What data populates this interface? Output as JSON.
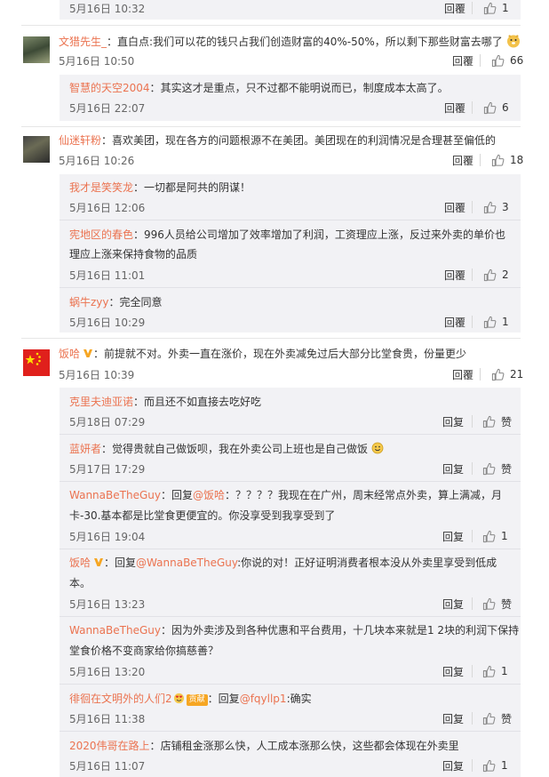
{
  "labels": {
    "reply": "回覆",
    "reply2": "回复",
    "like": "赞",
    "reply_prefix": "回复"
  },
  "top_item": {
    "time": "5月16日 10:32",
    "likes": "1"
  },
  "comments": [
    {
      "name": "文猎先生_",
      "text": "直白点:我们可以花的钱只占我们创造财富的40%-50%，所以剩下那些财富去哪了",
      "time": "5月16日 10:50",
      "likes": "66",
      "replies": [
        {
          "name": "智慧的天空2004",
          "text": "其实这才是重点，只不过都不能明说而已，制度成本太高了。",
          "time": "5月16日 22:07",
          "likes": "6"
        }
      ]
    },
    {
      "name": "仙迷轩粉",
      "text": "喜欢美团，现在各方的问题根源不在美团。美团现在的利润情况是合理甚至偏低的",
      "time": "5月16日 10:26",
      "likes": "18",
      "replies": [
        {
          "name": "我才是笑笑龙",
          "text": "一切都是阿共的阴谋！",
          "time": "5月16日 12:06",
          "likes": "3"
        },
        {
          "name": "宪地区的春色",
          "text": "996人员给公司增加了效率增加了利润，工资理应上涨，反过来外卖的单价也",
          "text2": "理应上涨来保持食物的品质",
          "time": "5月16日 11:01",
          "likes": "2"
        },
        {
          "name": "蜗牛zyy",
          "text": "完全同意",
          "time": "5月16日 10:29",
          "likes": "1"
        }
      ]
    },
    {
      "name": "饭哈",
      "text": "前提就不对。外卖一直在涨价，现在外卖减免过后大部分比堂食贵，份量更少",
      "time": "5月16日 10:39",
      "likes": "21",
      "replies": [
        {
          "name": "克里夫迪亚诺",
          "text": "而且还不如直接去吃好吃",
          "time": "5月18日 07:29",
          "likes": "赞"
        },
        {
          "name": "蓝妍者",
          "text": "觉得贵就自己做饭呗，我在外卖公司上班也是自己做饭",
          "time": "5月17日 17:29",
          "likes": "赞"
        },
        {
          "name": "WannaBeTheGuy",
          "at": "@饭哈",
          "text": "：？？？？我现在在广州，周末经常点外卖，算上满减，月",
          "text2": "卡-30.基本都是比堂食更便宜的。你没享受到我享受到了",
          "time": "5月16日 19:04",
          "likes": "1"
        },
        {
          "name": "饭哈",
          "at": "@WannaBeTheGuy",
          "text": ":你说的对！正好证明消费者根本没从外卖里享受到低成",
          "text2": "本。",
          "time": "5月16日 13:23",
          "likes": "赞"
        },
        {
          "name": "WannaBeTheGuy",
          "text": "因为外卖涉及到各种优惠和平台费用，十几块本来就是1 2块的利润下保持",
          "text2": "堂食价格不变商家给你搞慈善？",
          "time": "5月16日 13:20",
          "likes": "1"
        },
        {
          "name": "徘徊在文明外的人们2",
          "badge": "贡献",
          "at": "@fqyllp1",
          "text": ":确实",
          "time": "5月16日 11:38",
          "likes": "赞"
        },
        {
          "name": "2020伟哥在路上",
          "text": "店铺租金涨那么快，人工成本涨那么快，这些都会体现在外卖里",
          "time": "5月16日 11:07",
          "likes": "1"
        }
      ]
    }
  ]
}
